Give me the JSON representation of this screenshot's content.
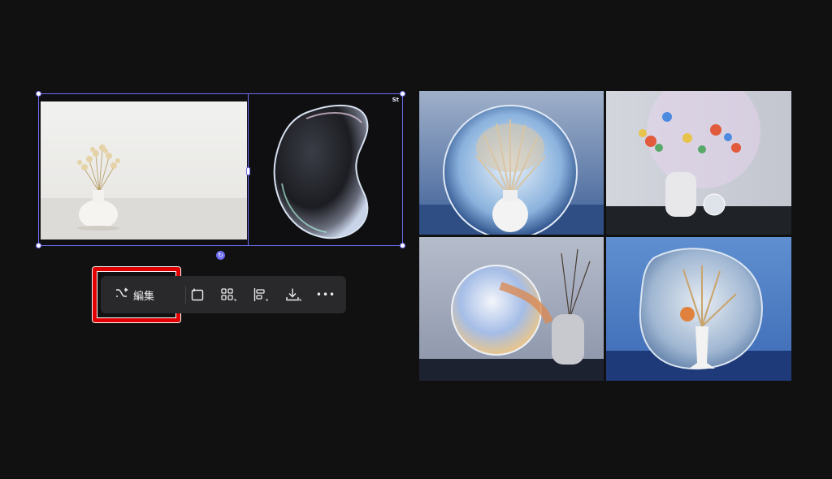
{
  "selection": {
    "badge": "St"
  },
  "toolbar": {
    "edit_label": "編集",
    "more_label": "•••"
  },
  "icons": {
    "edit": "shuffle-icon",
    "resize": "resize-icon",
    "arrange": "grid-layout-icon",
    "align": "align-icon",
    "download": "download-icon",
    "more": "more-icon",
    "rotate": "rotate-icon"
  },
  "colors": {
    "background": "#111112",
    "selection": "#6d6cf0",
    "highlight": "#e00000",
    "toolbar": "#29292c"
  }
}
